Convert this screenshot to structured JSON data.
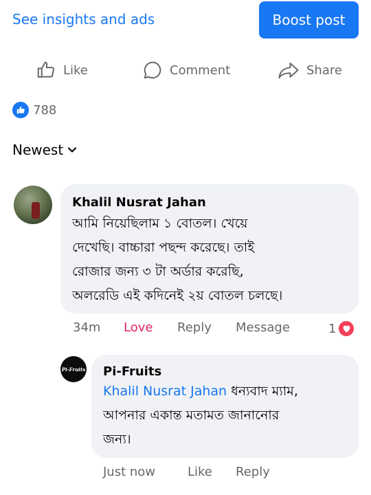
{
  "top": {
    "insights_link": "See insights and ads",
    "boost_button": "Boost post"
  },
  "actions": {
    "like": "Like",
    "comment": "Comment",
    "share": "Share"
  },
  "reactions": {
    "count": "788",
    "icon": "like-icon"
  },
  "sort": {
    "label": "Newest"
  },
  "comments": [
    {
      "author": "Khalil Nusrat Jahan",
      "lines": [
        "আমি নিয়েছিলাম ১ বোতল। খেয়ে",
        "দেখেছি। বাচ্চারা পছন্দ করেছে। তাই",
        "রোজার জন্য ৩ টা অর্ডার করেছি,",
        "অলরেডি এই কদিনেই ২য় বোতল চলছে।"
      ],
      "time": "34m",
      "reaction_label": "Love",
      "reply": "Reply",
      "message": "Message",
      "reaction_count": "1"
    },
    {
      "author": "Pi-Fruits",
      "avatar_text": "Pi-Fruits",
      "mention": "Khalil Nusrat Jahan",
      "line1_rest": " ধন্যবাদ ম্যাম,",
      "lines": [
        "আপনার একান্ত মতামত জানানোর",
        "জন্য।"
      ],
      "time": "Just now",
      "like": "Like",
      "reply": "Reply"
    }
  ],
  "colors": {
    "accent": "#1877f2",
    "love": "#e0245e",
    "bubble": "#f0f2f5",
    "muted": "#65676b"
  }
}
